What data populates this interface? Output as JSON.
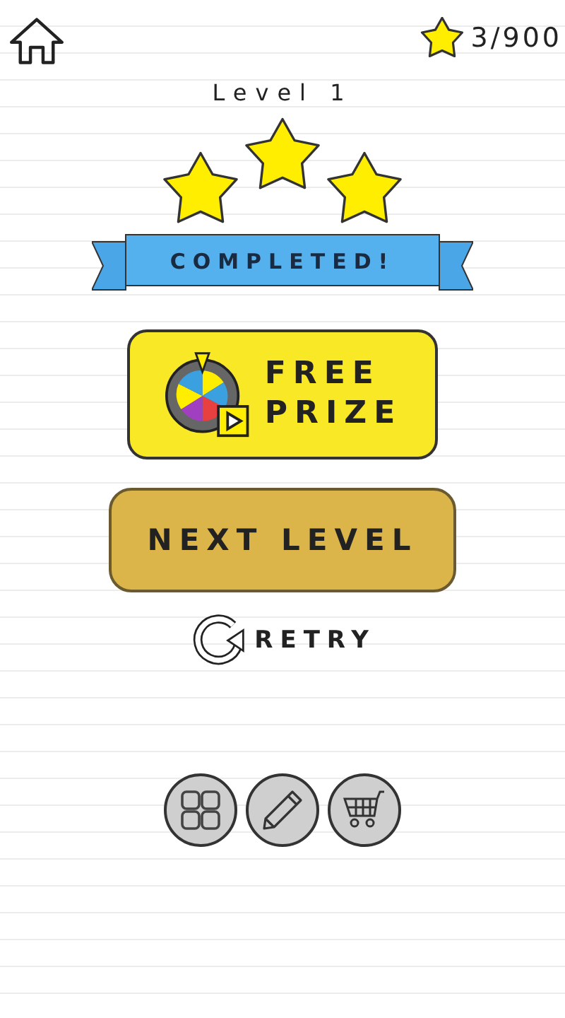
{
  "header": {
    "score": "3/900"
  },
  "level_title": "Level 1",
  "stars": 3,
  "banner": "COMPLETED!",
  "free_prize_button": {
    "lines": [
      "FREE",
      "PRIZE"
    ]
  },
  "next_level_button": {
    "label": "NEXT LEVEL"
  },
  "retry_button": {
    "label": "RETRY"
  }
}
